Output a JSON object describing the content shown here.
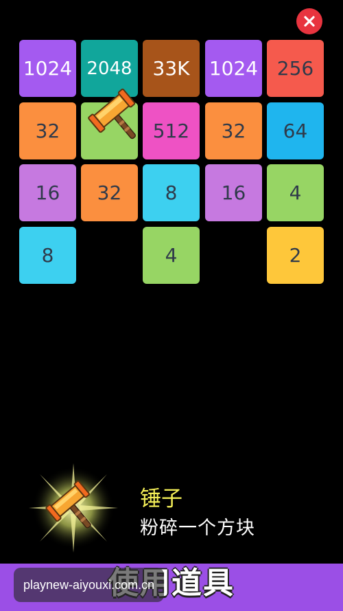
{
  "close": {
    "icon": "close-icon",
    "color": "#e8343f"
  },
  "board": {
    "tiles": [
      {
        "value": "1024",
        "color": "#a45af0"
      },
      {
        "value": "2048",
        "color": "#11a69b"
      },
      {
        "value": "33K",
        "color": "#a7541a"
      },
      {
        "value": "1024",
        "color": "#a45af0"
      },
      {
        "value": "256",
        "color": "#f55a4d"
      },
      {
        "value": "32",
        "color": "#fb8f3f"
      },
      {
        "value": "",
        "color": "#97d564",
        "tool": "hammer-icon"
      },
      {
        "value": "512",
        "color": "#ee52c4"
      },
      {
        "value": "32",
        "color": "#fb8f3f"
      },
      {
        "value": "64",
        "color": "#1fb5ee"
      },
      {
        "value": "16",
        "color": "#c679e0"
      },
      {
        "value": "32",
        "color": "#fb8f3f"
      },
      {
        "value": "8",
        "color": "#3dd0f0"
      },
      {
        "value": "16",
        "color": "#c679e0"
      },
      {
        "value": "4",
        "color": "#97d564"
      },
      {
        "value": "8",
        "color": "#3dd0f0"
      },
      {
        "value": "4",
        "color": "#97d564"
      },
      {
        "value": "2",
        "color": "#fec73a"
      }
    ]
  },
  "tool": {
    "icon": "hammer-icon",
    "name": "锤子",
    "description": "粉碎一个方块"
  },
  "footer": {
    "title": "使用道具",
    "watermark": "playnew-aiyouxi.com.cn",
    "bar_color": "#9b4fe6"
  }
}
